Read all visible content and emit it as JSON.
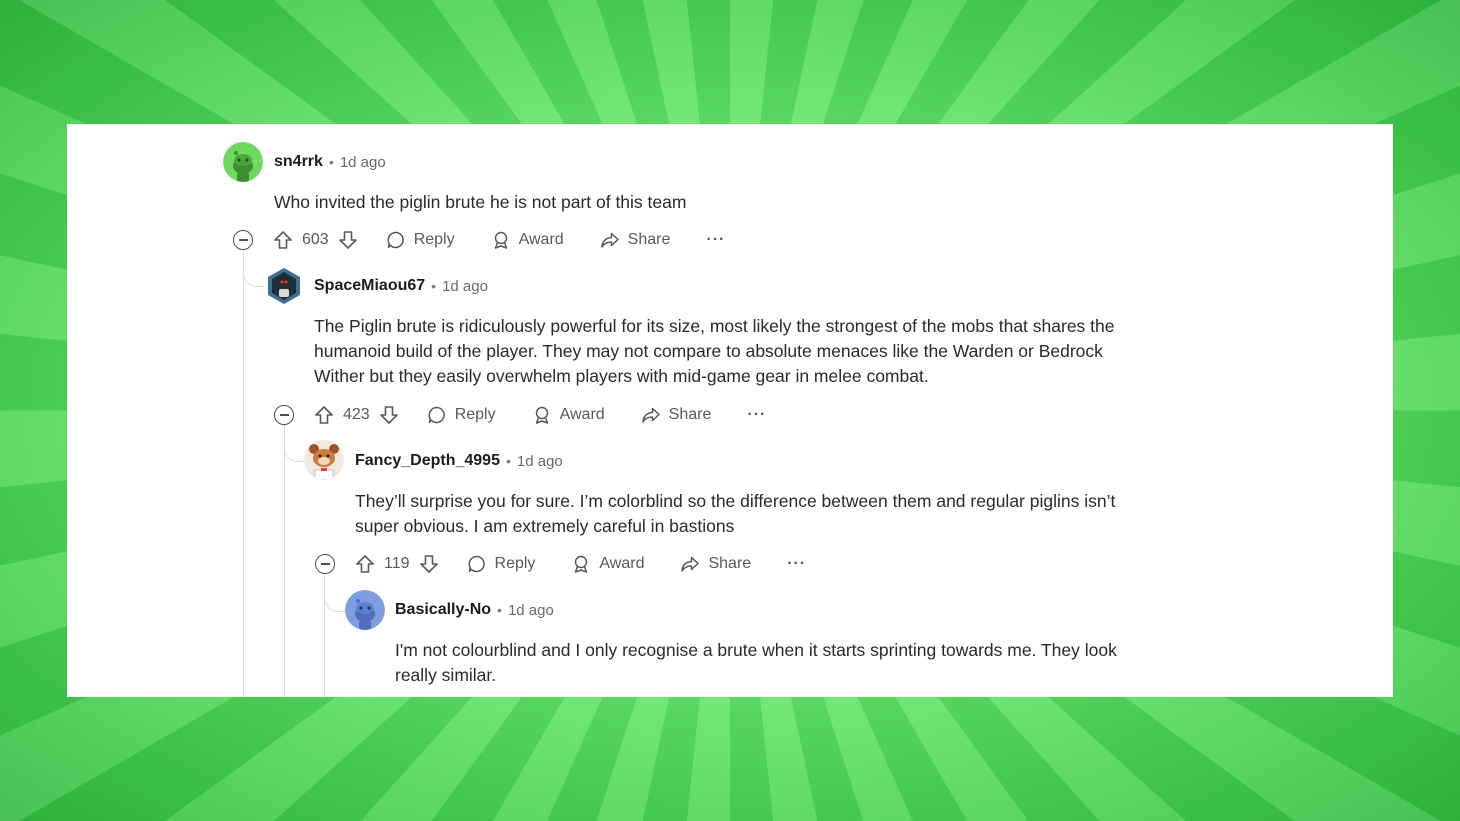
{
  "comments": [
    {
      "username": "sn4rrk",
      "time": "1d ago",
      "text": "Who invited the piglin brute he is not part of this team",
      "votes": "603",
      "reply_label": "Reply",
      "award_label": "Award",
      "share_label": "Share",
      "more_label": "···",
      "avatar_color": "#6fd85e"
    },
    {
      "username": "SpaceMiaou67",
      "time": "1d ago",
      "text": "The Piglin brute is ridiculously powerful for its size, most likely the strongest of the mobs that shares the humanoid build of the player. They may not compare to absolute menaces like the Warden or Bedrock Wither but they easily overwhelm players with mid-game gear in melee combat.",
      "votes": "423",
      "reply_label": "Reply",
      "award_label": "Award",
      "share_label": "Share",
      "more_label": "···",
      "avatar_color": "#3d6f8e"
    },
    {
      "username": "Fancy_Depth_4995",
      "time": "1d ago",
      "text": "They’ll surprise you for sure. I’m colorblind so the difference between them and regular piglins isn’t super obvious. I am extremely careful in bastions",
      "votes": "119",
      "reply_label": "Reply",
      "award_label": "Award",
      "share_label": "Share",
      "more_label": "···",
      "avatar_color": "#f2e8e0"
    },
    {
      "username": "Basically-No",
      "time": "1d ago",
      "text": "I'm not colourblind and I only recognise a brute when it starts sprinting towards me. They look really similar.",
      "avatar_color": "#7f9ee0"
    }
  ],
  "colors": {
    "background_green": "#6ded72",
    "thread_line": "#d9dde0",
    "text": "#2a2a2a"
  }
}
